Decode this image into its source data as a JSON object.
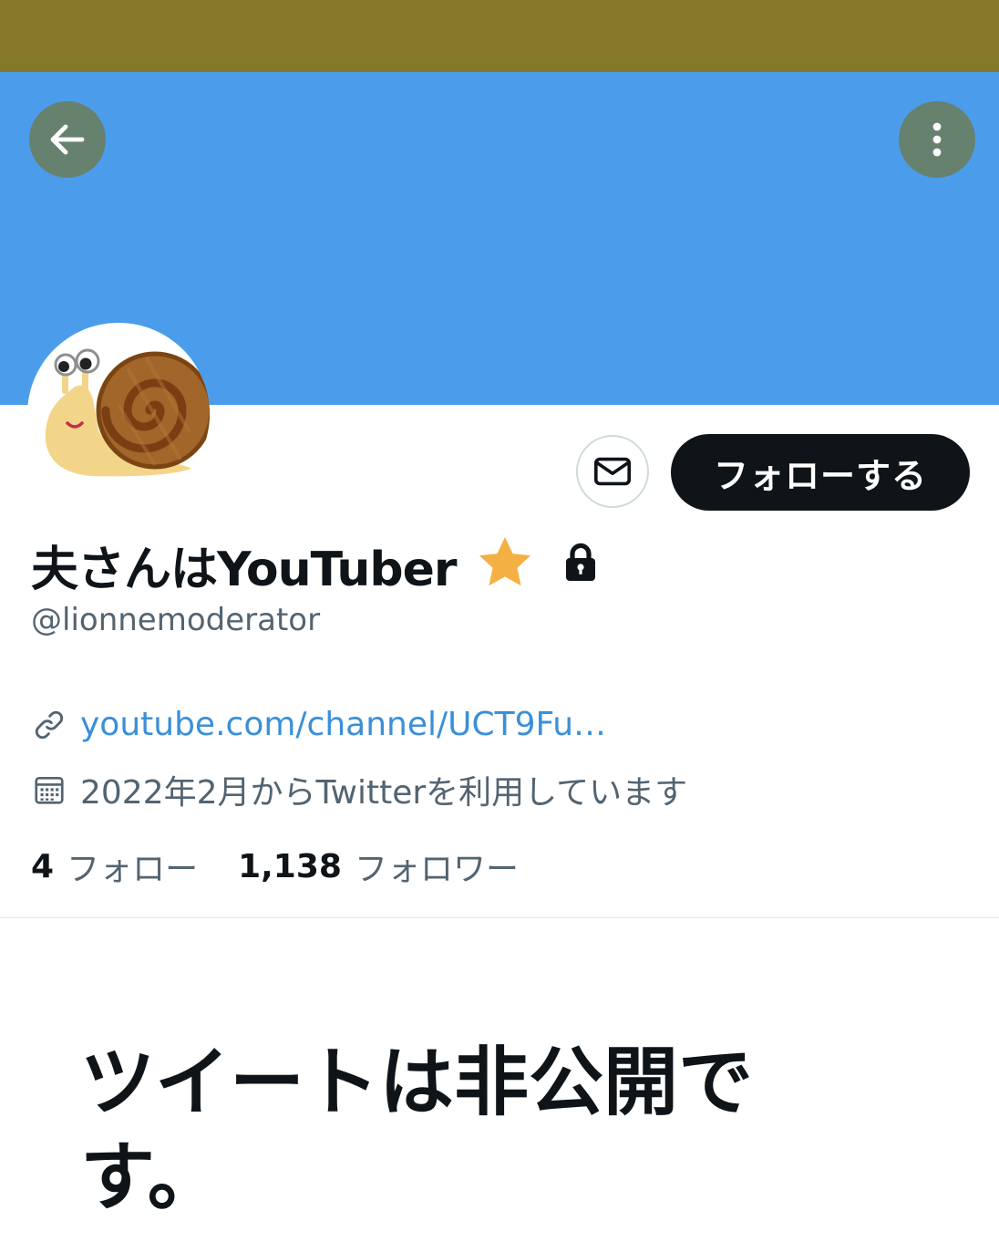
{
  "colors": {
    "status_strip": "#847928",
    "banner": "#4b9deb",
    "follow_button_bg": "#0f1419",
    "follow_button_text": "#ffffff",
    "star": "#f4b042",
    "link": "#3b8fd8",
    "secondary_text": "#536471"
  },
  "header": {
    "back_icon": "arrow-left-icon",
    "more_icon": "more-vertical-icon"
  },
  "profile": {
    "avatar_icon": "snail-icon",
    "message_icon": "envelope-icon",
    "follow_label": "フォローする",
    "display_name": "夫さんはYouTuber",
    "star_icon": "star-icon",
    "lock_icon": "lock-icon",
    "handle": "@lionnemoderator",
    "link_icon": "link-icon",
    "link_text": "youtube.com/channel/UCT9Fu…",
    "calendar_icon": "calendar-icon",
    "joined_text": "2022年2月からTwitterを利用しています",
    "following_count": "4",
    "following_label": "フォロー",
    "followers_count": "1,138",
    "followers_label": "フォロワー"
  },
  "content": {
    "private_message": "ツイートは非公開です。"
  }
}
